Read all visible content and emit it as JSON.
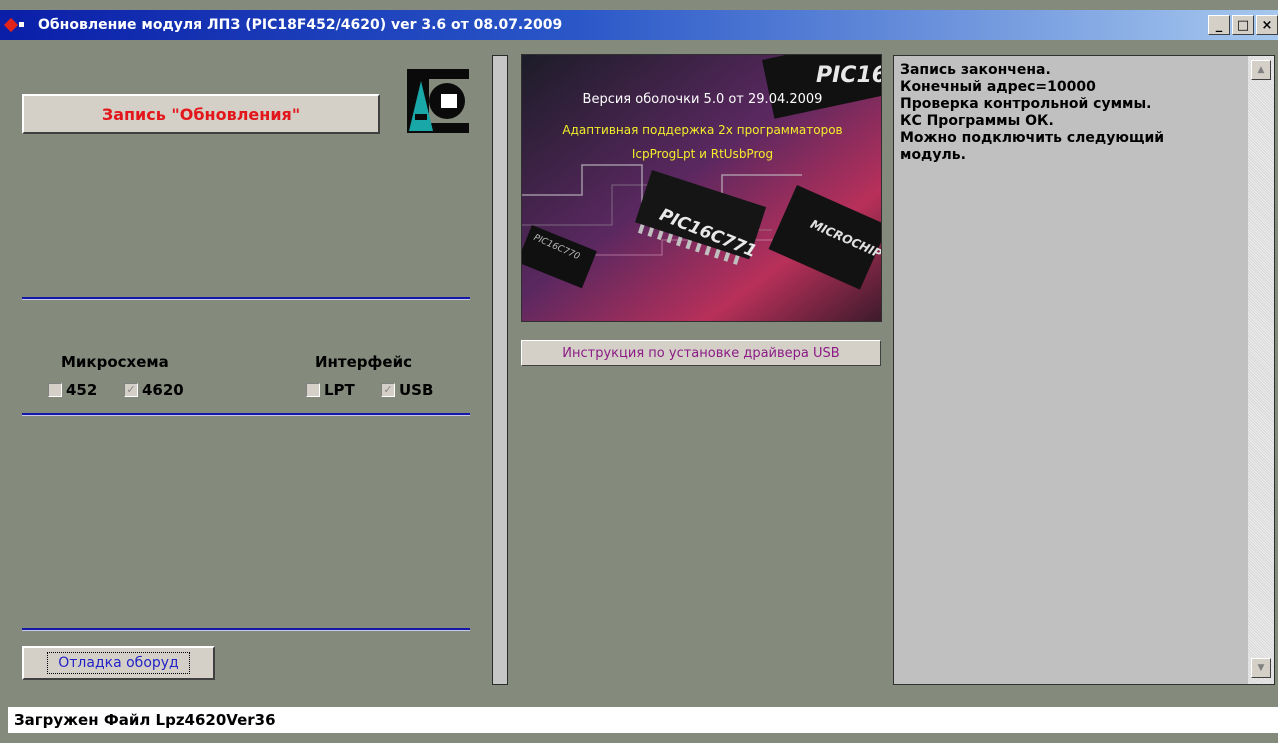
{
  "window": {
    "title": "Обновление модуля ЛПЗ (PIC18F452/4620) ver 3.6 от 08.07.2009",
    "controls": {
      "minimize": "_",
      "maximize": "□",
      "close": "×"
    }
  },
  "left_panel": {
    "write_button": "Запись \"Обновления\"",
    "chip_group": {
      "label": "Микросхема",
      "options": [
        {
          "label": "452",
          "checked": false
        },
        {
          "label": "4620",
          "checked": true
        }
      ]
    },
    "interface_group": {
      "label": "Интерфейс",
      "options": [
        {
          "label": "LPT",
          "checked": false
        },
        {
          "label": "USB",
          "checked": true
        }
      ]
    },
    "debug_button": "Отладка оборуд"
  },
  "center_panel": {
    "banner": {
      "version_line": "Версия оболочки 5.0 от 29.04.2009",
      "line2": "Адаптивная поддержка 2х программаторов",
      "line3": "IcpProgLpt и RtUsbProg",
      "chip_labels": [
        "PIC16",
        "PIC16C771",
        "PIC16C770",
        "MICROCHIP"
      ]
    },
    "usb_instructions_button": "Инструкция по установке драйвера USB"
  },
  "log": {
    "lines": [
      "Запись закончена.",
      "Конечный адрес=10000",
      "Проверка контрольной суммы.",
      "КС Программы ОК.",
      "Можно подключить следующий",
      "модуль."
    ]
  },
  "status_bar": {
    "text": "Загружен Файл Lpz4620Ver36"
  }
}
